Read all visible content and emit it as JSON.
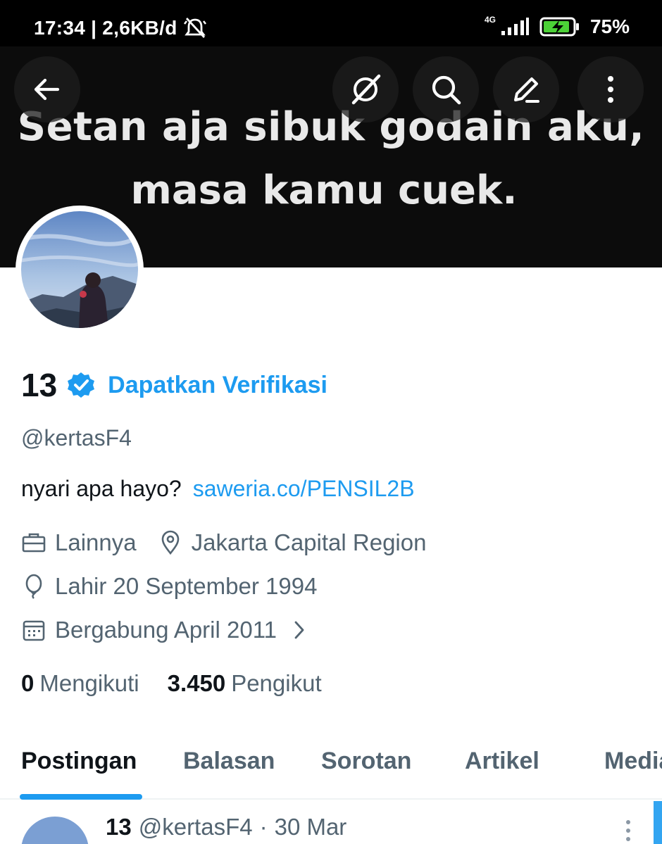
{
  "status_bar": {
    "time": "17:34",
    "separator": "|",
    "net_speed": "2,6KB/d",
    "network_type": "4G",
    "battery": "75%"
  },
  "banner": {
    "line1": "Setan aja sibuk godain aku,",
    "line2": "masa kamu cuek."
  },
  "top_actions": {
    "back_icon": "arrow-left-icon",
    "grok_icon": "grok-icon",
    "search_icon": "search-icon",
    "edit_icon": "pencil-icon",
    "more_icon": "more-vertical-icon"
  },
  "profile": {
    "name": "13",
    "verify_label": "Dapatkan Verifikasi",
    "handle": "@kertasF4",
    "bio_text": "nyari apa hayo?",
    "bio_link": "saweria.co/PENSIL2B",
    "category": "Lainnya",
    "location": "Jakarta Capital Region",
    "birthday": "Lahir 20 September 1994",
    "joined": "Bergabung April 2011",
    "following_count": "0",
    "following_label": "Mengikuti",
    "followers_count": "3.450",
    "followers_label": "Pengikut"
  },
  "tabs": [
    "Postingan",
    "Balasan",
    "Sorotan",
    "Artikel",
    "Media"
  ],
  "post": {
    "author_name": "13",
    "author_handle": "@kertasF4",
    "dot": "·",
    "date": "30 Mar"
  },
  "colors": {
    "accent": "#1d9bf0",
    "text_primary": "#0f1419",
    "text_secondary": "#536471"
  }
}
